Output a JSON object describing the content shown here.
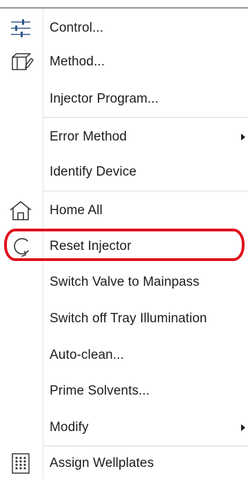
{
  "menu": {
    "items": [
      {
        "label": "Control...",
        "icon": "sliders-icon"
      },
      {
        "label": "Method...",
        "icon": "method-edit-icon"
      },
      {
        "label": "Injector Program...",
        "icon": ""
      },
      {
        "label": "Error Method",
        "icon": "",
        "submenu": true
      },
      {
        "label": "Identify Device",
        "icon": ""
      },
      {
        "label": "Home All",
        "icon": "home-icon"
      },
      {
        "label": "Reset Injector",
        "icon": "reset-circle-arrow-icon",
        "highlighted": true
      },
      {
        "label": "Switch Valve to Mainpass",
        "icon": ""
      },
      {
        "label": "Switch off Tray Illumination",
        "icon": ""
      },
      {
        "label": "Auto-clean...",
        "icon": ""
      },
      {
        "label": "Prime Solvents...",
        "icon": ""
      },
      {
        "label": "Modify",
        "icon": "",
        "submenu": true
      },
      {
        "label": "Assign Wellplates",
        "icon": "wellplate-grid-icon"
      }
    ]
  },
  "colors": {
    "highlight_outline": "#e0101a",
    "text": "#1c1c1c",
    "separator": "#d9d9d9"
  }
}
